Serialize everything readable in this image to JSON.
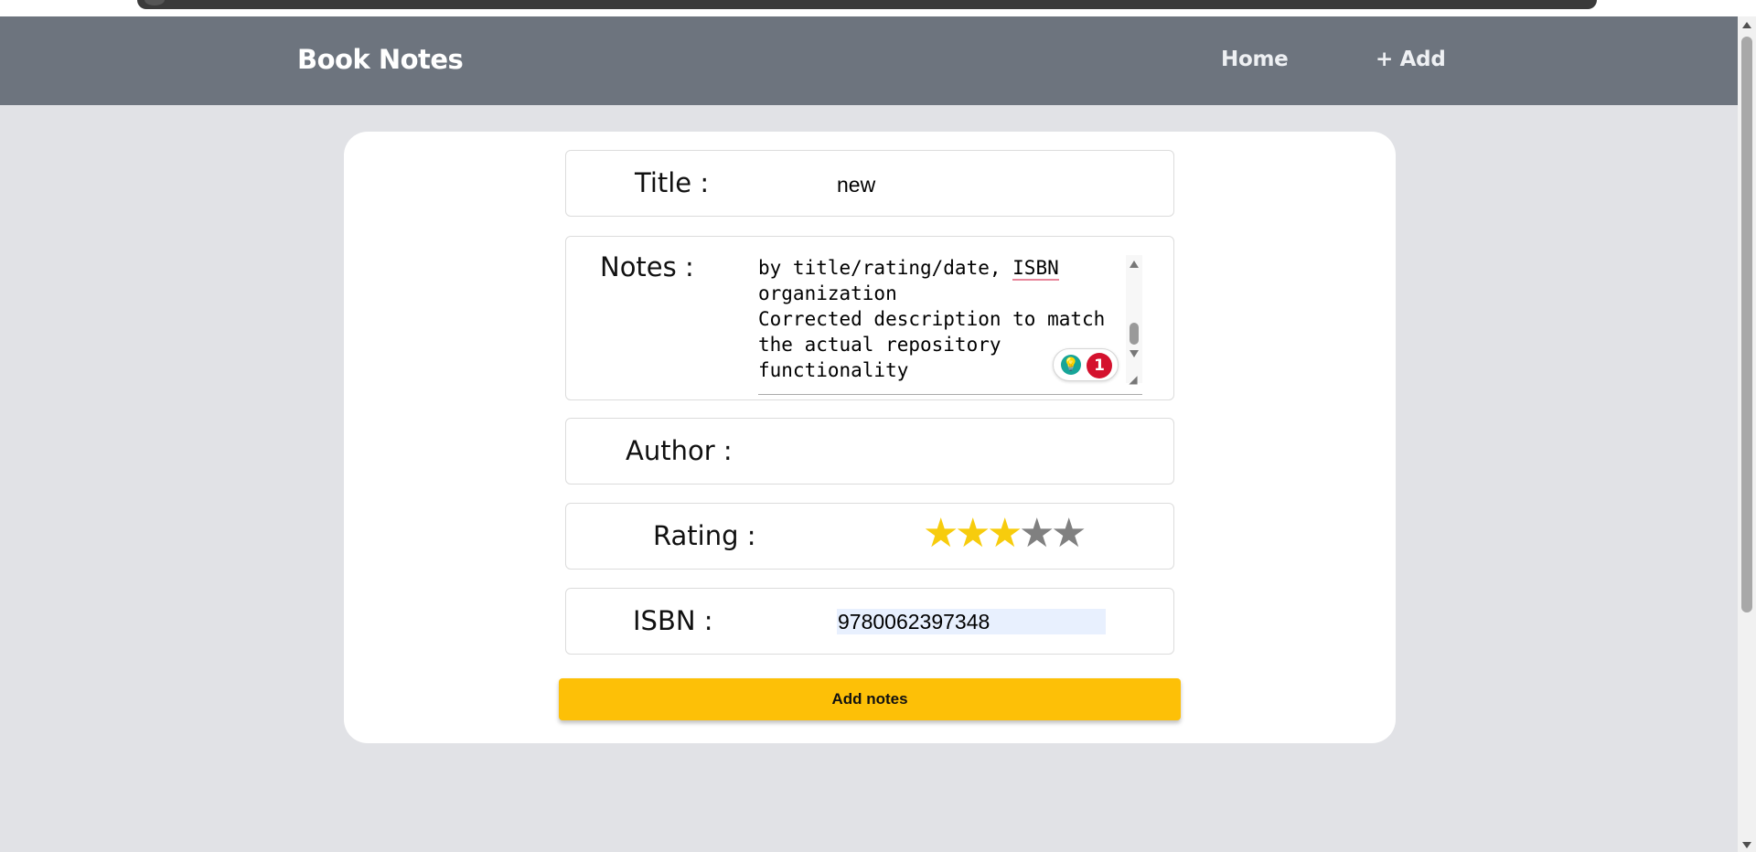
{
  "nav": {
    "brand": "Book Notes",
    "links": [
      {
        "label": "Home"
      },
      {
        "label": "+ Add"
      }
    ]
  },
  "form": {
    "title": {
      "label": "Title :",
      "value": "new"
    },
    "notes": {
      "label": "Notes :",
      "visible_lines": [
        "by title/rating/date, ",
        "ISBN",
        "organization",
        "Corrected description to match",
        "the actual repository",
        "functionality"
      ],
      "grammar_issue_count": "1"
    },
    "author": {
      "label": "Author :",
      "value": ""
    },
    "rating": {
      "label": "Rating :",
      "value": 3,
      "max": 5,
      "filled_color": "#f7cc0d",
      "empty_color": "#808080",
      "star_glyph": "★"
    },
    "isbn": {
      "label": "ISBN :",
      "value": "9780062397348"
    },
    "submit_label": "Add notes"
  },
  "colors": {
    "navbar": "#6d747e",
    "page_bg": "#e1e2e6",
    "button": "#fdc007"
  }
}
